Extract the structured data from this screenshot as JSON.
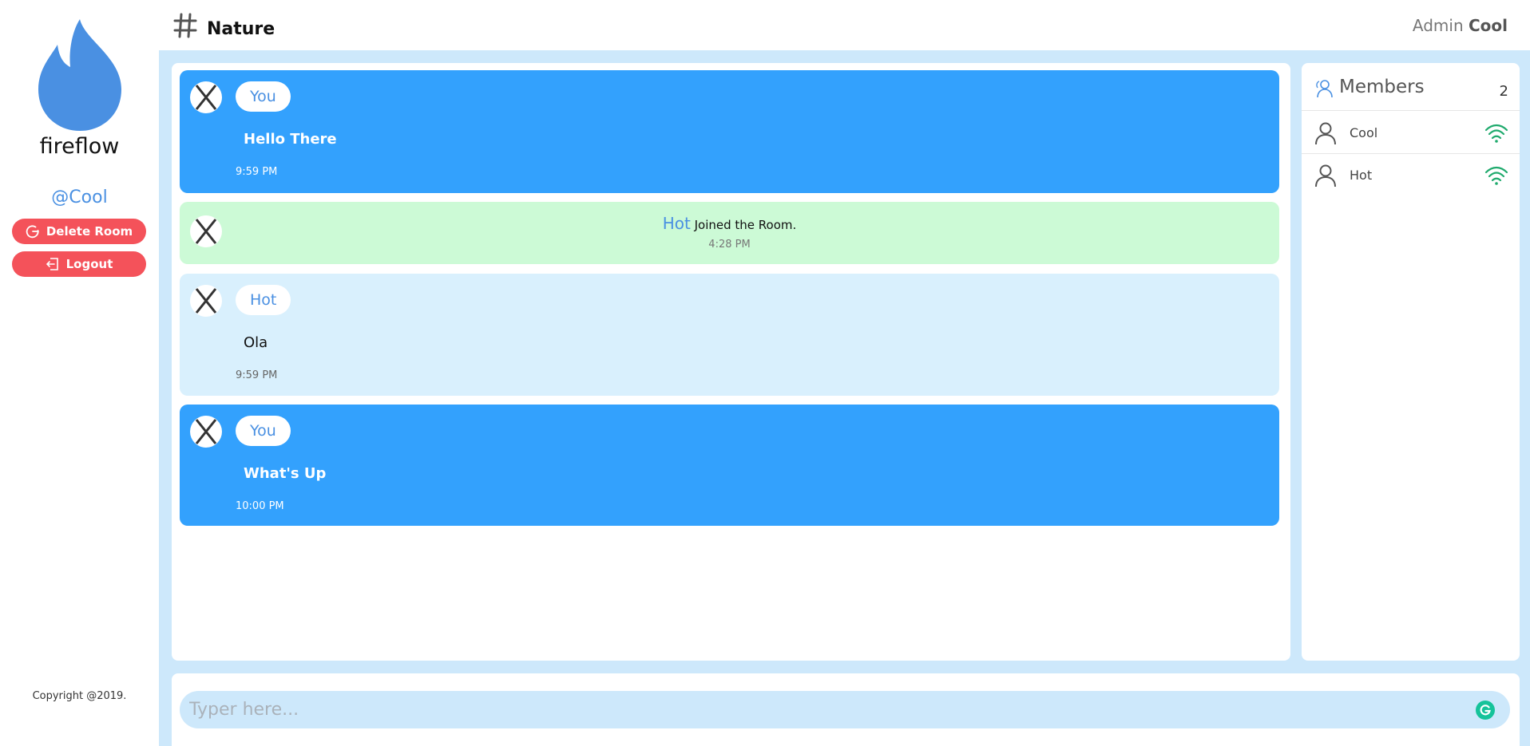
{
  "sidebar": {
    "brand": "fireflow",
    "handle": "@Cool",
    "delete_label": "Delete Room",
    "logout_label": "Logout",
    "copyright": "Copyright @2019."
  },
  "header": {
    "room_name": "Nature",
    "admin_prefix": "Admin",
    "admin_name": "Cool"
  },
  "messages": [
    {
      "type": "own",
      "name": "You",
      "text": "Hello There",
      "time": "9:59 PM"
    },
    {
      "type": "system",
      "user": "Hot",
      "text": "Joined the Room.",
      "time": "4:28 PM"
    },
    {
      "type": "other",
      "name": "Hot",
      "text": "Ola",
      "time": "9:59 PM"
    },
    {
      "type": "own",
      "name": "You",
      "text": "What's Up",
      "time": "10:00 PM"
    }
  ],
  "members": {
    "title": "Members",
    "count": "2",
    "list": [
      {
        "name": "Cool"
      },
      {
        "name": "Hot"
      }
    ]
  },
  "composer": {
    "placeholder": "Typer here..."
  },
  "colors": {
    "brand_blue": "#4a90e2",
    "own_bubble": "#33a1fd",
    "other_bubble": "#d9f0fd",
    "system_bubble": "#ccfad6",
    "danger": "#f4525a",
    "online": "#1faa6d",
    "background": "#cde8fb"
  }
}
